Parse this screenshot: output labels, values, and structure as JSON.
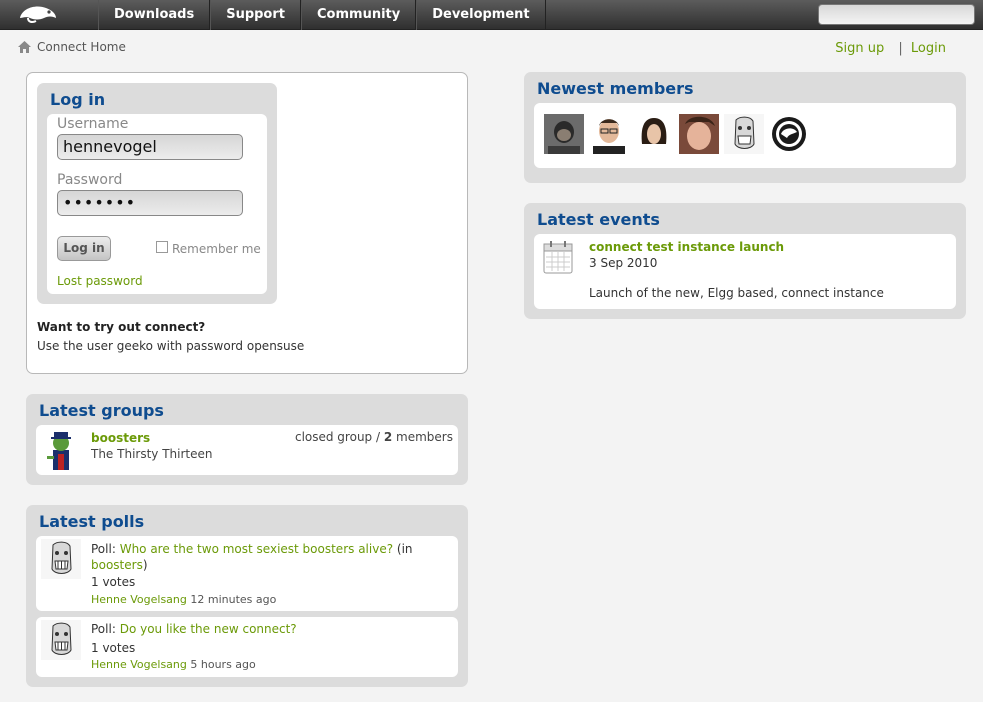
{
  "topbar": {
    "nav": [
      "Downloads",
      "Support",
      "Community",
      "Development"
    ],
    "search_placeholder": ""
  },
  "breadcrumb": {
    "label": "Connect Home"
  },
  "auth": {
    "signup": "Sign up",
    "separator": "|",
    "login": "Login"
  },
  "login_box": {
    "title": "Log in",
    "username_label": "Username",
    "username_value": "hennevogel",
    "password_label": "Password",
    "password_value": "•••••••",
    "login_button": "Log in",
    "remember_me": "Remember me",
    "lost_password": "Lost password",
    "try_title": "Want to try out connect?",
    "try_text": "Use the user geeko with password opensuse"
  },
  "latest_groups": {
    "title": "Latest groups",
    "item": {
      "name": "boosters",
      "description": "The Thirsty Thirteen",
      "meta_prefix": "closed group /",
      "member_count": "2",
      "member_suffix": "members"
    }
  },
  "latest_polls": {
    "title": "Latest polls",
    "items": [
      {
        "prefix": "Poll:",
        "question": "Who are the two most sexiest boosters alive?",
        "in_prefix": "(in",
        "in_group": "boosters",
        "in_suffix": ")",
        "votes": "1 votes",
        "author": "Henne Vogelsang",
        "time": "12 minutes ago"
      },
      {
        "prefix": "Poll:",
        "question": "Do you like the new connect?",
        "votes": "1 votes",
        "author": "Henne Vogelsang",
        "time": "5 hours ago"
      }
    ]
  },
  "newest_members": {
    "title": "Newest members"
  },
  "latest_events": {
    "title": "Latest events",
    "item": {
      "name": "connect test instance launch",
      "date": "3 Sep 2010",
      "description": "Launch of the new, Elgg based, connect instance"
    }
  }
}
